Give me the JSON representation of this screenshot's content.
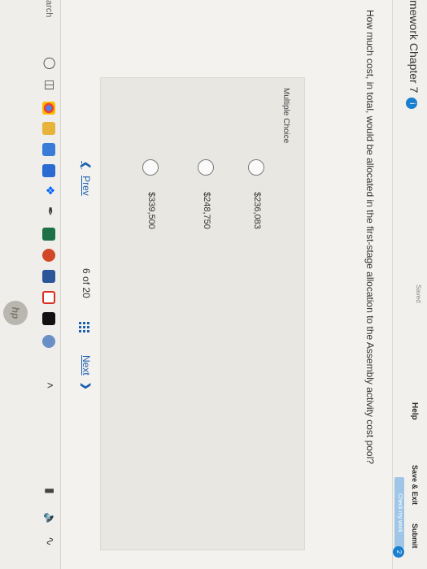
{
  "header": {
    "chapter_title": "mework Chapter 7",
    "info_badge": "i",
    "saved_text": "Saved",
    "help": "Help",
    "save_exit": "Save & Exit",
    "submit": "Submit",
    "check_work": "Check my work",
    "question_badge": "2"
  },
  "question": {
    "text": "How much cost, in total, would be allocated in the first-stage allocation to the Assembly activity cost pool?"
  },
  "answers": {
    "label": "Multiple Choice",
    "options": [
      {
        "text": "$236,083",
        "selected": false
      },
      {
        "text": "$248,750",
        "selected": false
      },
      {
        "text": "$339,500",
        "selected": false
      }
    ]
  },
  "navigation": {
    "prev": "Prev",
    "page_current": "6",
    "page_of": "of",
    "page_total": "20",
    "next": "Next"
  },
  "taskbar": {
    "search_text": "arch",
    "hp_logo": "hp",
    "icons": [
      "cortana-icon",
      "task-view-icon",
      "chrome-icon",
      "file-explorer-icon",
      "store-icon",
      "mail-icon",
      "dropbox-icon",
      "feather-icon",
      "excel-icon",
      "powerpoint-icon",
      "word-icon",
      "gmail-icon",
      "netflix-icon",
      "user-icon",
      "tray-up-icon",
      "battery-icon",
      "speaker-icon",
      "network-icon"
    ]
  },
  "colors": {
    "accent": "#1a7fcf",
    "link": "#1b5fb0",
    "check_work_bg": "#9fc6e6"
  }
}
